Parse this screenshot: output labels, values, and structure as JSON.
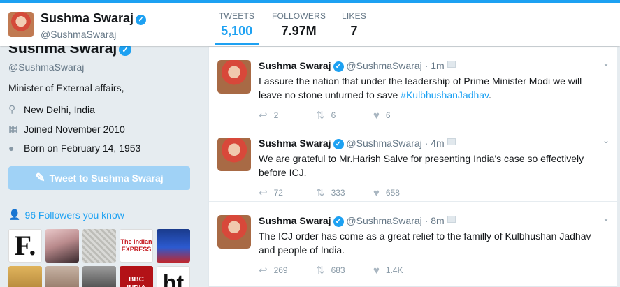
{
  "header": {
    "name": "Sushma Swaraj",
    "handle": "@SushmaSwaraj",
    "stats": [
      {
        "label": "TWEETS",
        "value": "5,100"
      },
      {
        "label": "FOLLOWERS",
        "value": "7.97M"
      },
      {
        "label": "LIKES",
        "value": "7"
      }
    ]
  },
  "profile": {
    "name": "Sushma Swaraj",
    "handle": "@SushmaSwaraj",
    "bio": "Minister of External affairs,",
    "location": "New Delhi, India",
    "joined": "Joined November 2010",
    "born": "Born on February 14, 1953",
    "tweet_to": "Tweet to Sushma Swaraj",
    "followers_you_know": "96 Followers you know",
    "thumbs": [
      {
        "text": "F."
      },
      {
        "text": ""
      },
      {
        "text": ""
      },
      {
        "text": "The Indian EXPRESS"
      },
      {
        "text": ""
      },
      {
        "text": ""
      },
      {
        "text": ""
      },
      {
        "text": ""
      },
      {
        "text": "BBC INDIA"
      },
      {
        "text": "ht"
      }
    ]
  },
  "tweets": [
    {
      "name": "Sushma Swaraj",
      "handle": "@SushmaSwaraj",
      "time": "1m",
      "text": "I assure the nation that under the leadership of Prime Minister Modi we will leave no stone unturned to save ",
      "hashtag": "#KulbhushanJadhav",
      "suffix": ".",
      "replies": "2",
      "retweets": "6",
      "likes": "6"
    },
    {
      "name": "Sushma Swaraj",
      "handle": "@SushmaSwaraj",
      "time": "4m",
      "text": "We are grateful to Mr.Harish Salve for presenting India's case so effectively before ICJ.",
      "hashtag": "",
      "suffix": "",
      "replies": "72",
      "retweets": "333",
      "likes": "658"
    },
    {
      "name": "Sushma Swaraj",
      "handle": "@SushmaSwaraj",
      "time": "8m",
      "text": "The ICJ order has come as a great relief to the familly of Kulbhushan Jadhav and people of India.",
      "hashtag": "",
      "suffix": "",
      "replies": "269",
      "retweets": "683",
      "likes": "1.4K"
    }
  ],
  "colors": {
    "accent": "#1da1f2",
    "background": "#e6ecf0",
    "muted": "#657786"
  }
}
